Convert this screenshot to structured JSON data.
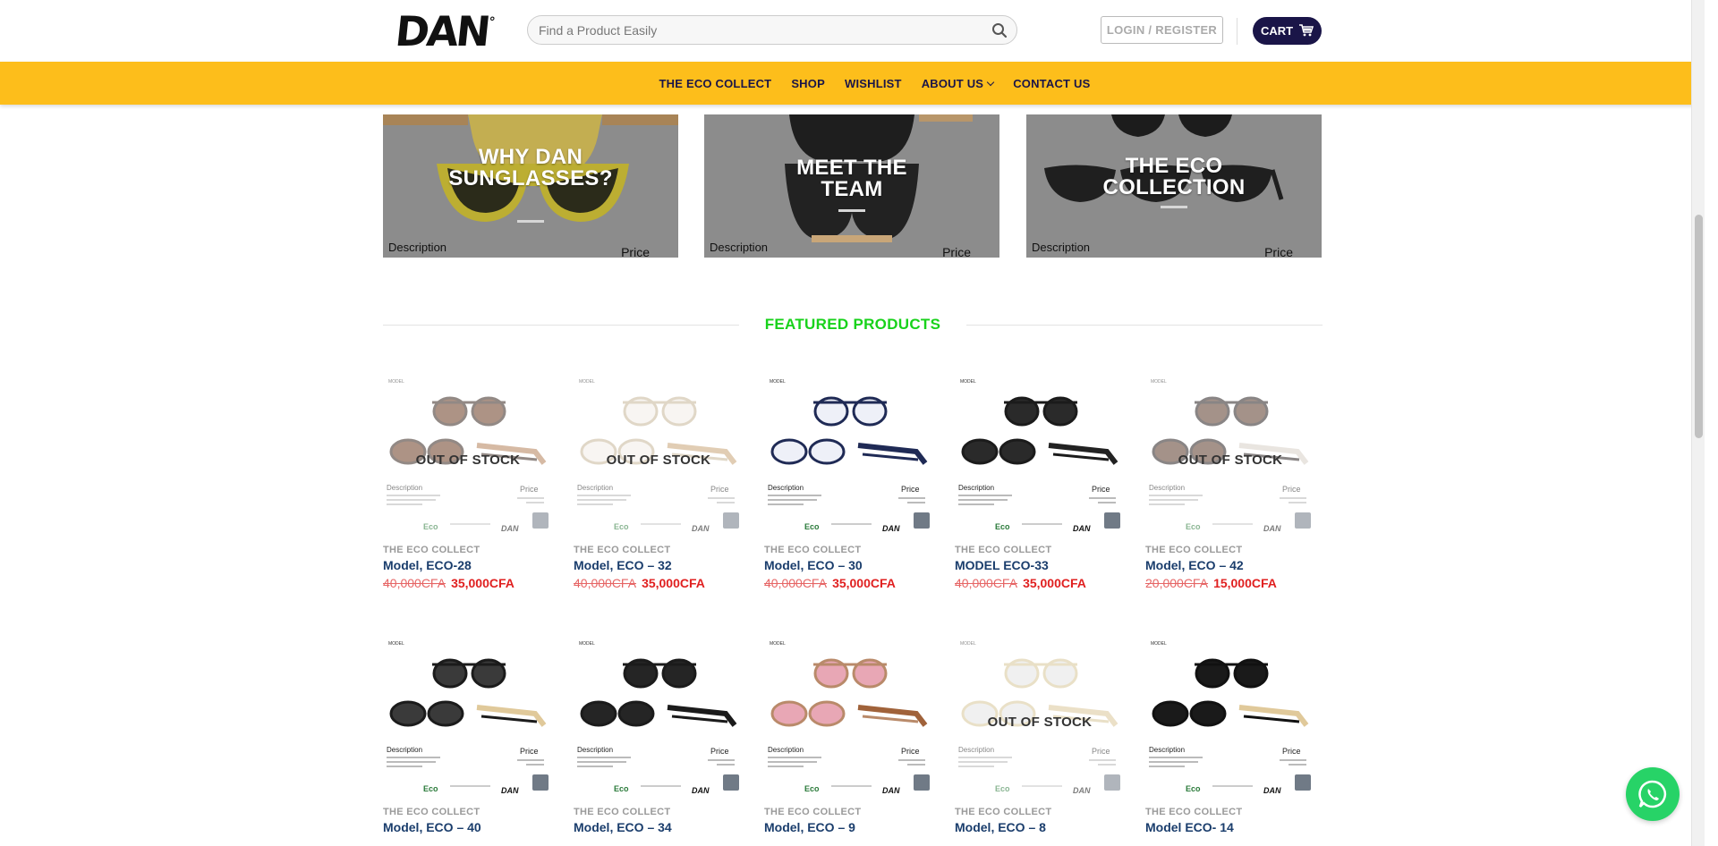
{
  "header": {
    "logo_text": "DAN",
    "logo_mark": "°",
    "search_placeholder": "Find a Product Easily",
    "login_label": "LOGIN / REGISTER",
    "cart_label": "CART",
    "cart_icon": "cart-icon",
    "search_icon": "search-icon"
  },
  "nav": {
    "items": [
      {
        "label": "THE ECO COLLECT"
      },
      {
        "label": "SHOP"
      },
      {
        "label": "WISHLIST"
      },
      {
        "label": "ABOUT US"
      },
      {
        "label": "CONTACT US"
      }
    ]
  },
  "banners": [
    {
      "title_line1": "WHY DAN",
      "title_line2": "SUNGLASSES?",
      "description": "Description",
      "price": "Price"
    },
    {
      "title_line1": "MEET THE",
      "title_line2": "TEAM",
      "description": "Description",
      "price": "Price"
    },
    {
      "title_line1": "THE ECO",
      "title_line2": "COLLECTION",
      "description": "Description",
      "price": "Price"
    }
  ],
  "featured": {
    "heading": "FEATURED PRODUCTS"
  },
  "products": [
    {
      "category": "THE ECO COLLECT",
      "title": "Model, ECO-28",
      "old_price": "40,000CFA",
      "new_price": "35,000CFA",
      "badge": "OUT OF STOCK"
    },
    {
      "category": "THE ECO COLLECT",
      "title": "Model, ECO – 32",
      "old_price": "40,000CFA",
      "new_price": "35,000CFA",
      "badge": "OUT OF STOCK"
    },
    {
      "category": "THE ECO COLLECT",
      "title": "Model, ECO – 30",
      "old_price": "40,000CFA",
      "new_price": "35,000CFA",
      "badge": ""
    },
    {
      "category": "THE ECO COLLECT",
      "title": "MODEL ECO-33",
      "old_price": "40,000CFA",
      "new_price": "35,000CFA",
      "badge": ""
    },
    {
      "category": "THE ECO COLLECT",
      "title": "Model, ECO – 42",
      "old_price": "20,000CFA",
      "new_price": "15,000CFA",
      "badge": "OUT OF STOCK"
    },
    {
      "category": "THE ECO COLLECT",
      "title": "Model, ECO – 40",
      "old_price": "",
      "new_price": "",
      "badge": ""
    },
    {
      "category": "THE ECO COLLECT",
      "title": "Model, ECO – 34",
      "old_price": "",
      "new_price": "",
      "badge": ""
    },
    {
      "category": "THE ECO COLLECT",
      "title": "Model, ECO – 9",
      "old_price": "",
      "new_price": "",
      "badge": ""
    },
    {
      "category": "THE ECO COLLECT",
      "title": "Model, ECO – 8",
      "old_price": "",
      "new_price": "",
      "badge": "OUT OF STOCK"
    },
    {
      "category": "THE ECO COLLECT",
      "title": "Model ECO- 14",
      "old_price": "",
      "new_price": "",
      "badge": ""
    }
  ],
  "product_image_text": {
    "description": "Description",
    "price": "Price",
    "brand": "DAN",
    "eco": "Eco"
  },
  "colors": {
    "accent_yellow": "#fdbe1b",
    "navy": "#1a1548",
    "featured_green": "#18d21b",
    "sale_red": "#e02020",
    "whatsapp_green": "#27d367"
  }
}
